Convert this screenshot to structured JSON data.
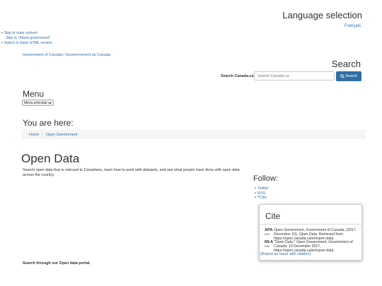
{
  "header": {
    "language_title": "Language selection",
    "language_link": "Français",
    "skip_links": [
      "Skip to main content",
      "Skip to \"About government\"",
      "Switch to basic HTML version"
    ],
    "goc_link": "Government of Canada / Gouvernement du Canada"
  },
  "search": {
    "title": "Search",
    "label": "Search Canada.ca",
    "placeholder": "Search Canada.ca",
    "button": "Search",
    "button_icon": "search-icon"
  },
  "menu": {
    "title": "Menu",
    "button": "Menu principal"
  },
  "breadcrumb": {
    "title": "You are here:",
    "items": [
      "Home",
      "Open Government"
    ]
  },
  "main": {
    "title": "Open Data",
    "intro": "Search open data that is relevant to Canadians, learn how to work with datasets, and see what people have done with open data across the country.",
    "portal_text": "Search through our Open data portal."
  },
  "follow": {
    "title": "Follow:",
    "items": [
      "Twitter",
      "RSS",
      "Cite"
    ]
  },
  "cite": {
    "title": "Cite",
    "apa_label": "APA",
    "apa_part1": "Open Government, Government of Canada. (2017, December 10). ",
    "apa_italic": "Open Data",
    "apa_part2": ". Retrieved from https://open.canada.ca/en/open-data",
    "mla_label": "MLA",
    "mla_part1": "\"Open Data.\" ",
    "mla_italic": "Open Government, Government of Canada",
    "mla_part2": ", 10 December 2017, https://open.canada.ca/en/open-data",
    "report_link": "(Report an issue with citation)"
  }
}
